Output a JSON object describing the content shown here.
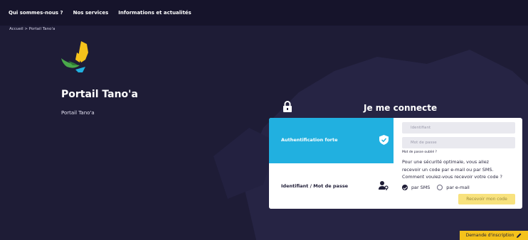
{
  "topnav": {
    "items": [
      {
        "label": "Qui sommes-nous ?"
      },
      {
        "label": "Nos services"
      },
      {
        "label": "Informations et actualités"
      }
    ]
  },
  "breadcrumb": {
    "home": "Accueil",
    "separator": ">",
    "current": "Portail Tano'a"
  },
  "hero": {
    "title": "Portail Tano'a",
    "subtitle": "Portail Tano'a"
  },
  "login": {
    "title": "Je me connecte",
    "tabs": {
      "strong_auth": "Authentification forte",
      "password": "Identifiant / Mot de passe"
    },
    "identifier_placeholder": "Identifiant",
    "password_placeholder": "Mot de passe",
    "forgot": "Mot de passe oublié ?",
    "info_line1": "Pour une sécurité optimale, vous allez",
    "info_line2": "recevoir un code par e-mail ou par SMS.",
    "info_line3": "Comment voulez-vous recevoir votre code ?",
    "option_sms": "par SMS",
    "option_email": "par e-mail",
    "submit": "Recevoir mon code"
  },
  "register_button": "Demande d'inscription",
  "colors": {
    "background": "#1e1c36",
    "accent_blue": "#21b0e0",
    "accent_yellow": "#f5c21b",
    "button_disabled": "#f8e27e"
  },
  "icons": {
    "lock": "lock-icon",
    "shield": "shield-check-icon",
    "user": "user-key-icon",
    "pencil": "pencil-icon"
  }
}
